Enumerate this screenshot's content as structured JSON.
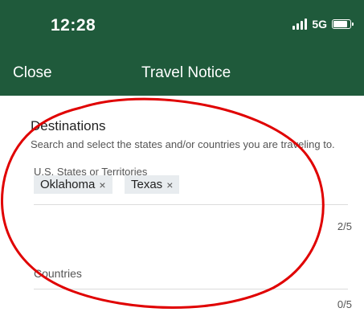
{
  "status_bar": {
    "time": "12:28",
    "network": "5G",
    "battery_level": 0.85
  },
  "nav": {
    "close_label": "Close",
    "title": "Travel Notice"
  },
  "destinations": {
    "title": "Destinations",
    "subtitle": "Search and select the states and/or countries you are traveling to.",
    "states_label": "U.S. States or Territories",
    "states_selected": [
      "Oklahoma",
      "Texas"
    ],
    "states_counter": "2/5",
    "countries_label": "Countries",
    "countries_counter": "0/5"
  },
  "remove_glyph": "×",
  "colors": {
    "header_bg": "#1f5a3b",
    "chip_bg": "#e8ecef",
    "annotation": "#e00000"
  }
}
